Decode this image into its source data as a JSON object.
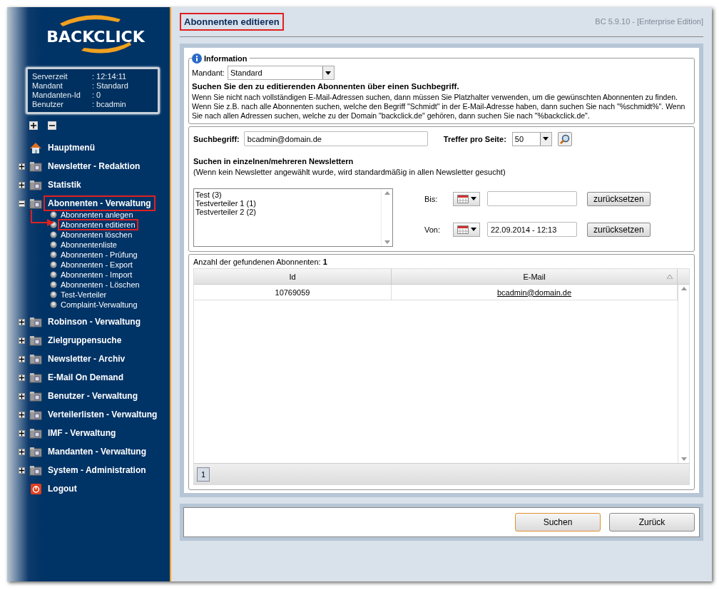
{
  "logo": {
    "text": "BACKCLICK"
  },
  "server_info": [
    {
      "label": "Serverzeit",
      "value": ": 12:14:11"
    },
    {
      "label": "Mandant",
      "value": ": Standard"
    },
    {
      "label": "Mandanten-Id",
      "value": ": 0"
    },
    {
      "label": "Benutzer",
      "value": ": bcadmin"
    }
  ],
  "sidebar": {
    "items": [
      {
        "kind": "home",
        "label": "Hauptmenü",
        "highlighted": false
      },
      {
        "kind": "folder",
        "label": "Newsletter - Redaktion",
        "expanded": false,
        "highlighted": false
      },
      {
        "kind": "folder",
        "label": "Statistik",
        "expanded": false,
        "highlighted": false
      },
      {
        "kind": "folder",
        "label": "Abonnenten - Verwaltung",
        "expanded": true,
        "highlighted": true,
        "children": [
          {
            "label": "Abonnenten anlegen",
            "highlighted": false
          },
          {
            "label": "Abonnenten editieren",
            "highlighted": true
          },
          {
            "label": "Abonnenten löschen",
            "highlighted": false
          },
          {
            "label": "Abonnentenliste",
            "highlighted": false
          },
          {
            "label": "Abonnenten - Prüfung",
            "highlighted": false
          },
          {
            "label": "Abonnenten - Export",
            "highlighted": false
          },
          {
            "label": "Abonnenten - Import",
            "highlighted": false
          },
          {
            "label": "Abonnenten - Löschen",
            "highlighted": false
          },
          {
            "label": "Test-Verteiler",
            "highlighted": false
          },
          {
            "label": "Complaint-Verwaltung",
            "highlighted": false
          }
        ]
      },
      {
        "kind": "folder",
        "label": "Robinson - Verwaltung",
        "expanded": false,
        "highlighted": false
      },
      {
        "kind": "folder",
        "label": "Zielgruppensuche",
        "expanded": false,
        "highlighted": false
      },
      {
        "kind": "folder",
        "label": "Newsletter - Archiv",
        "expanded": false,
        "highlighted": false
      },
      {
        "kind": "folder",
        "label": "E-Mail On Demand",
        "expanded": false,
        "highlighted": false
      },
      {
        "kind": "folder",
        "label": "Benutzer - Verwaltung",
        "expanded": false,
        "highlighted": false
      },
      {
        "kind": "folder",
        "label": "Verteilerlisten - Verwaltung",
        "expanded": false,
        "highlighted": false
      },
      {
        "kind": "folder",
        "label": "IMF - Verwaltung",
        "expanded": false,
        "highlighted": false
      },
      {
        "kind": "folder",
        "label": "Mandanten - Verwaltung",
        "expanded": false,
        "highlighted": false
      },
      {
        "kind": "folder",
        "label": "System - Administration",
        "expanded": false,
        "highlighted": false
      },
      {
        "kind": "logout",
        "label": "Logout",
        "highlighted": false
      }
    ]
  },
  "page": {
    "title": "Abonnenten editieren",
    "title_highlighted": true,
    "version": "BC 5.9.10 - [Enterprise Edition]"
  },
  "information": {
    "legend": "Information",
    "mandant_label": "Mandant:",
    "mandant_value": "Standard",
    "heading": "Suchen Sie den zu editierenden Abonnenten über einen Suchbegriff.",
    "text": "Wenn Sie nicht nach vollständigen E-Mail-Adressen suchen, dann müssen Sie Platzhalter verwenden, um die gewünschten Abonnenten zu finden. Wenn Sie z.B. nach alle Abonnenten suchen, welche den Begriff \"Schmidt\" in der E-Mail-Adresse haben, dann suchen Sie nach \"%schmidt%\". Wenn Sie nach allen Adressen suchen, welche zu der Domain \"backclick.de\" gehören, dann suchen Sie nach \"%backclick.de\"."
  },
  "search": {
    "label": "Suchbegriff:",
    "value": "bcadmin@domain.de",
    "per_page_label": "Treffer pro Seite:",
    "per_page_value": "50",
    "newsletter_heading": "Suchen in einzelnen/mehreren Newslettern",
    "newsletter_hint": "(Wenn kein Newsletter angewählt wurde, wird standardmäßig in allen Newsletter gesucht)",
    "newsletters": [
      {
        "label": "Test (3)",
        "selected": false
      },
      {
        "label": "Testverteiler 1 (1)",
        "selected": false
      },
      {
        "label": "Testverteiler 2 (2)",
        "selected": false
      }
    ],
    "dates": [
      {
        "label": "Bis:",
        "reset": "zurücksetzen"
      },
      {
        "label": "Von:",
        "value": "22.09.2014 - 12:13",
        "reset": "zurücksetzen"
      }
    ]
  },
  "results": {
    "count_label": "Anzahl der gefundenen Abonnenten:",
    "count": "1",
    "columns": [
      "Id",
      "E-Mail"
    ],
    "rows": [
      [
        "10769059",
        "bcadmin@domain.de"
      ]
    ],
    "pages": [
      {
        "label": "1",
        "selected": true
      }
    ]
  },
  "buttons": [
    "Suchen",
    "Zurück"
  ]
}
